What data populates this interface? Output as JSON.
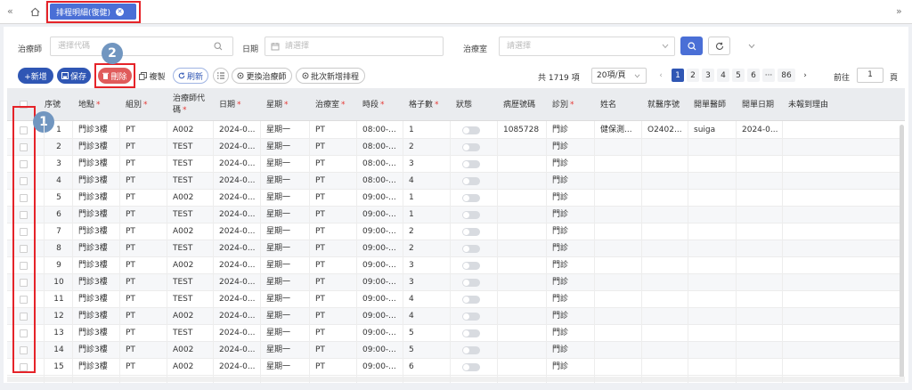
{
  "nav": {
    "left_arrow": "«",
    "right_arrow": "»",
    "home_icon": "home-icon"
  },
  "tab": {
    "label": "排程明細(復健)",
    "close": "✕"
  },
  "filters": {
    "therapist_label": "治療師",
    "therapist_placeholder": "選擇代碼",
    "date_label": "日期",
    "date_placeholder": "請選擇",
    "room_label": "治療室",
    "room_placeholder": "請選擇"
  },
  "toolbar": {
    "add": "+新增",
    "save": "保存",
    "delete": "刪除",
    "copy": "複製",
    "refresh": "刷新",
    "change_therapist": "更換治療師",
    "batch_add": "批次新增排程"
  },
  "annotations": {
    "badge1": "1",
    "badge2": "2"
  },
  "pagination": {
    "total": "共 1719 項",
    "page_size": "20項/頁",
    "pages": [
      "1",
      "2",
      "3",
      "4",
      "5",
      "6",
      "···",
      "86"
    ],
    "prev": "‹",
    "next": "›",
    "goto_label": "前往",
    "goto_value": "1",
    "page_suffix": "頁"
  },
  "table": {
    "columns": [
      "序號",
      "地點",
      "組別",
      "治療師代碼",
      "日期",
      "星期",
      "治療室",
      "時段",
      "格子數",
      "狀態",
      "病歷號碼",
      "診別",
      "姓名",
      "就醫序號",
      "開單醫師",
      "開單日期",
      "未報到理由"
    ],
    "rows": [
      [
        "1",
        "門診3樓",
        "PT",
        "A002",
        "2024-0...",
        "星期一",
        "PT",
        "08:00-...",
        "1",
        "",
        "1085728",
        "門診",
        "健保測...",
        "O2402...",
        "suiga",
        "2024-0...",
        ""
      ],
      [
        "2",
        "門診3樓",
        "PT",
        "TEST",
        "2024-0...",
        "星期一",
        "PT",
        "08:00-...",
        "2",
        "",
        "",
        "門診",
        "",
        "",
        "",
        "",
        ""
      ],
      [
        "3",
        "門診3樓",
        "PT",
        "TEST",
        "2024-0...",
        "星期一",
        "PT",
        "08:00-...",
        "3",
        "",
        "",
        "門診",
        "",
        "",
        "",
        "",
        ""
      ],
      [
        "4",
        "門診3樓",
        "PT",
        "TEST",
        "2024-0...",
        "星期一",
        "PT",
        "08:00-...",
        "4",
        "",
        "",
        "門診",
        "",
        "",
        "",
        "",
        ""
      ],
      [
        "5",
        "門診3樓",
        "PT",
        "A002",
        "2024-0...",
        "星期一",
        "PT",
        "09:00-...",
        "1",
        "",
        "",
        "門診",
        "",
        "",
        "",
        "",
        ""
      ],
      [
        "6",
        "門診3樓",
        "PT",
        "TEST",
        "2024-0...",
        "星期一",
        "PT",
        "09:00-...",
        "1",
        "",
        "",
        "門診",
        "",
        "",
        "",
        "",
        ""
      ],
      [
        "7",
        "門診3樓",
        "PT",
        "A002",
        "2024-0...",
        "星期一",
        "PT",
        "09:00-...",
        "2",
        "",
        "",
        "門診",
        "",
        "",
        "",
        "",
        ""
      ],
      [
        "8",
        "門診3樓",
        "PT",
        "TEST",
        "2024-0...",
        "星期一",
        "PT",
        "09:00-...",
        "2",
        "",
        "",
        "門診",
        "",
        "",
        "",
        "",
        ""
      ],
      [
        "9",
        "門診3樓",
        "PT",
        "A002",
        "2024-0...",
        "星期一",
        "PT",
        "09:00-...",
        "3",
        "",
        "",
        "門診",
        "",
        "",
        "",
        "",
        ""
      ],
      [
        "10",
        "門診3樓",
        "PT",
        "TEST",
        "2024-0...",
        "星期一",
        "PT",
        "09:00-...",
        "3",
        "",
        "",
        "門診",
        "",
        "",
        "",
        "",
        ""
      ],
      [
        "11",
        "門診3樓",
        "PT",
        "TEST",
        "2024-0...",
        "星期一",
        "PT",
        "09:00-...",
        "4",
        "",
        "",
        "門診",
        "",
        "",
        "",
        "",
        ""
      ],
      [
        "12",
        "門診3樓",
        "PT",
        "A002",
        "2024-0...",
        "星期一",
        "PT",
        "09:00-...",
        "4",
        "",
        "",
        "門診",
        "",
        "",
        "",
        "",
        ""
      ],
      [
        "13",
        "門診3樓",
        "PT",
        "TEST",
        "2024-0...",
        "星期一",
        "PT",
        "09:00-...",
        "5",
        "",
        "",
        "門診",
        "",
        "",
        "",
        "",
        ""
      ],
      [
        "14",
        "門診3樓",
        "PT",
        "A002",
        "2024-0...",
        "星期一",
        "PT",
        "09:00-...",
        "5",
        "",
        "",
        "門診",
        "",
        "",
        "",
        "",
        ""
      ],
      [
        "15",
        "門診3樓",
        "PT",
        "A002",
        "2024-0...",
        "星期一",
        "PT",
        "09:00-...",
        "6",
        "",
        "",
        "門診",
        "",
        "",
        "",
        "",
        ""
      ]
    ]
  }
}
